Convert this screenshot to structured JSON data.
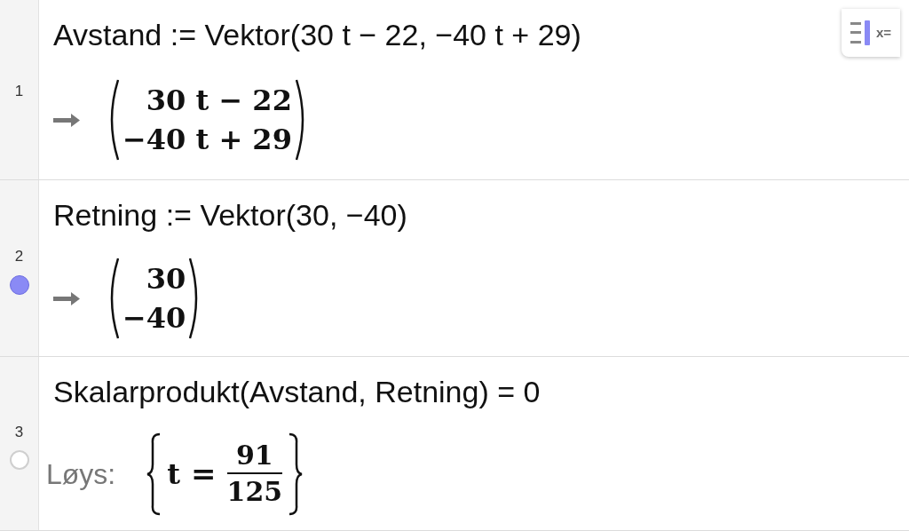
{
  "toggle_button": {
    "label": "x="
  },
  "rows": [
    {
      "number": "1",
      "input": "Avstand := Vektor(30 t − 22, −40 t + 29)",
      "output": {
        "kind": "vector",
        "entries": [
          "30 t − 22",
          "−40 t + 29"
        ]
      }
    },
    {
      "number": "2",
      "visible": true,
      "input": "Retning := Vektor(30, −40)",
      "output": {
        "kind": "vector",
        "entries": [
          "30",
          "−40"
        ]
      }
    },
    {
      "number": "3",
      "visible": false,
      "input": "Skalarprodukt(Avstand, Retning) = 0",
      "output": {
        "kind": "solution",
        "prefix": "Løys:",
        "variable": "t",
        "relation": "=",
        "numerator": "91",
        "denominator": "125"
      }
    }
  ]
}
